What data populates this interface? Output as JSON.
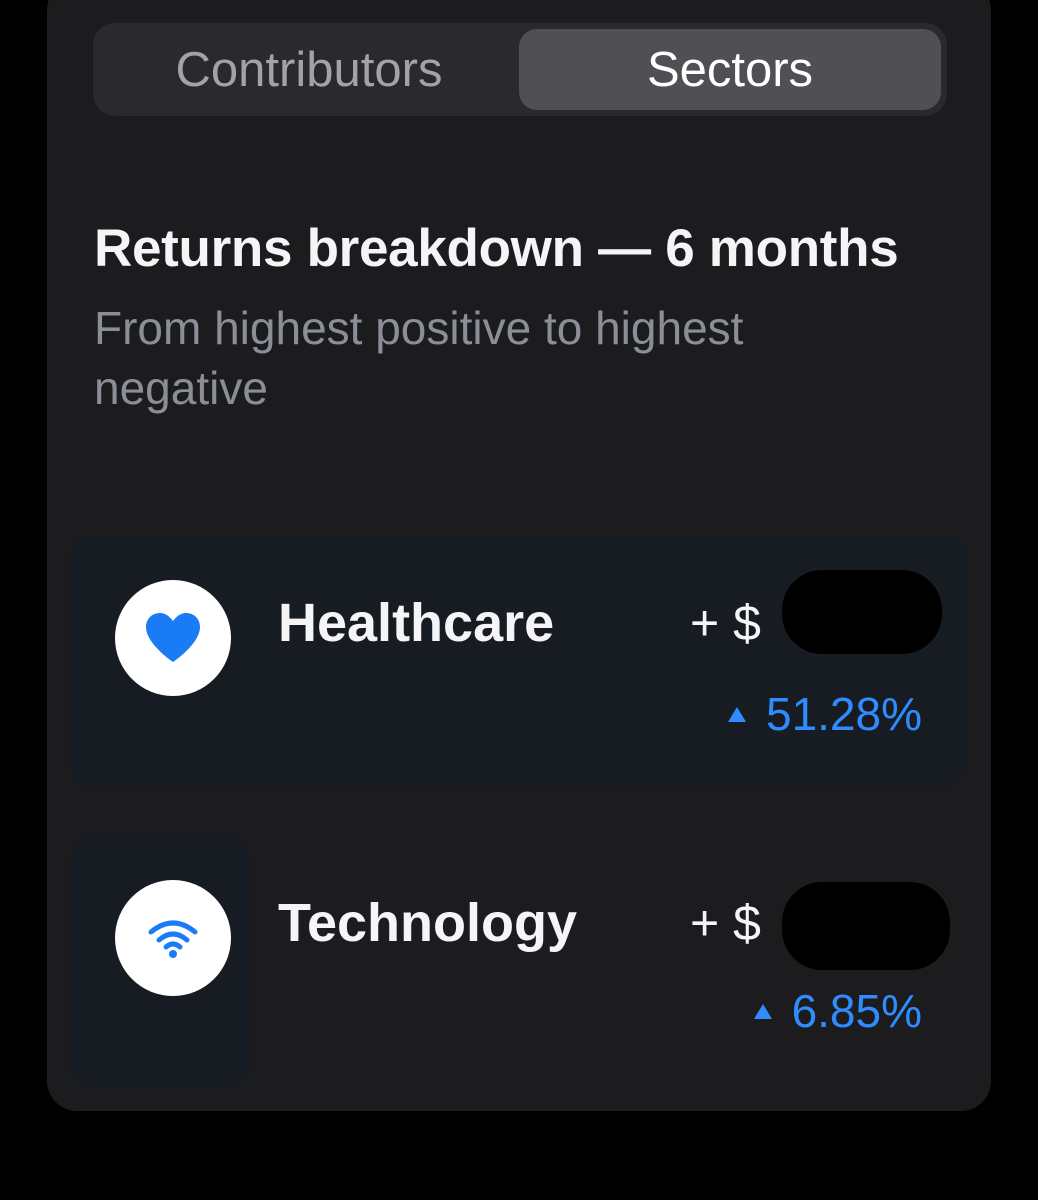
{
  "tabs": {
    "contributors_label": "Contributors",
    "sectors_label": "Sectors",
    "selected": "Sectors"
  },
  "section": {
    "title": "Returns breakdown — 6 months",
    "subtitle": "From highest positive to highest negative"
  },
  "sectors": [
    {
      "name": "Healthcare",
      "icon": "heart-icon",
      "amount_prefix": "+ $",
      "change": "51.28%",
      "direction": "up"
    },
    {
      "name": "Technology",
      "icon": "wifi-icon",
      "amount_prefix": "+ $",
      "change": "6.85%",
      "direction": "up"
    }
  ],
  "colors": {
    "accent": "#2f8cff",
    "card_bg": "#1c1c1e",
    "row_bg": "#171c23"
  }
}
